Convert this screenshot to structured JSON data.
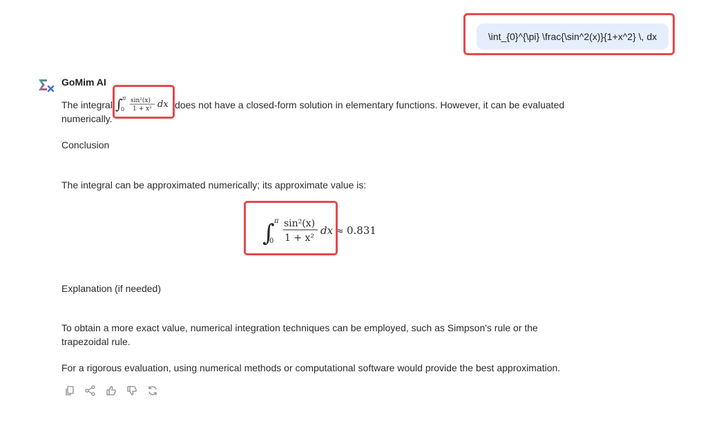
{
  "user_message": {
    "text": "\\int_{0}^{\\pi} \\frac{\\sin^2(x)}{1+x^2} \\, dx"
  },
  "assistant": {
    "name": "GoMim AI",
    "logo_icon": "sigma-x-logo",
    "para1_before": "The integral",
    "para1_after": "does not have a closed-form solution in elementary functions. However, it can be evaluated",
    "para1_line2": "numerically.",
    "heading_conclusion": "Conclusion",
    "para2": "The integral can be approximated numerically; its approximate value is:",
    "approx_value": "0.831",
    "heading_explanation": "Explanation (if needed)",
    "para3_line1": "To obtain a more exact value, numerical integration techniques can be employed, such as Simpson's rule or the",
    "para3_line2": "trapezoidal rule.",
    "para4": "For a rigorous evaluation, using numerical methods or computational software would provide the best approximation."
  },
  "math": {
    "integral_upper": "π",
    "integral_lower": "0",
    "numerator": "sin²(x)",
    "denominator": "1 + x²",
    "differential": "dx",
    "approx_symbol": "≈"
  },
  "toolbar": {
    "icons": [
      "copy-icon",
      "share-icon",
      "thumbs-up-icon",
      "thumbs-down-icon",
      "regenerate-icon"
    ]
  },
  "colors": {
    "highlight": "#e5484d",
    "bubble": "#e5eefc"
  }
}
